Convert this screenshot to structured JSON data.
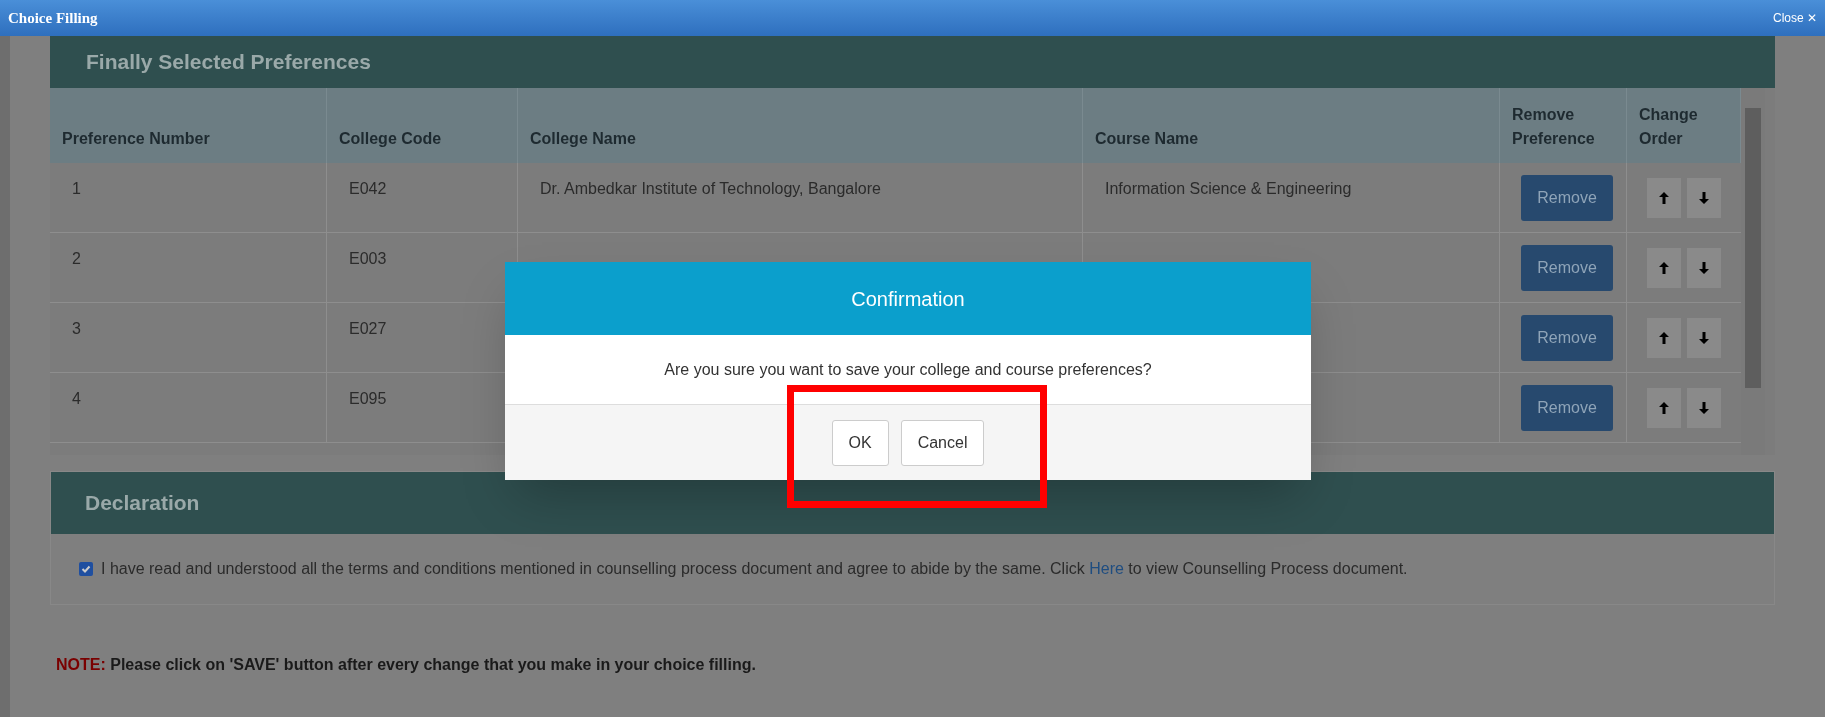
{
  "window": {
    "title": "Choice Filling",
    "close_label": "Close ✕"
  },
  "preferences": {
    "title": "Finally Selected Preferences",
    "columns": [
      "Preference Number",
      "College Code",
      "College Name",
      "Course Name",
      "Remove Preference",
      "Change Order"
    ],
    "rows": [
      {
        "number": "1",
        "code": "E042",
        "college": "Dr. Ambedkar Institute of Technology, Bangalore",
        "course": "Information Science & Engineering",
        "remove_label": "Remove"
      },
      {
        "number": "2",
        "code": "E003",
        "remove_label": "Remove"
      },
      {
        "number": "3",
        "code": "E027",
        "remove_label": "Remove"
      },
      {
        "number": "4",
        "code": "E095",
        "remove_label": "Remove"
      }
    ]
  },
  "declaration": {
    "title": "Declaration",
    "checked": true,
    "text_before": "I have read and understood all the terms and conditions mentioned in counselling process document and agree to abide by the same. Click",
    "link": "Here",
    "text_after": "to view Counselling Process document."
  },
  "note": {
    "label": "NOTE:",
    "text": "Please click on 'SAVE' button after every change that you make in your choice filling."
  },
  "dialog": {
    "title": "Confirmation",
    "message": "Are you sure you want to save your college and course preferences?",
    "buttons": [
      "OK",
      "Cancel"
    ]
  }
}
